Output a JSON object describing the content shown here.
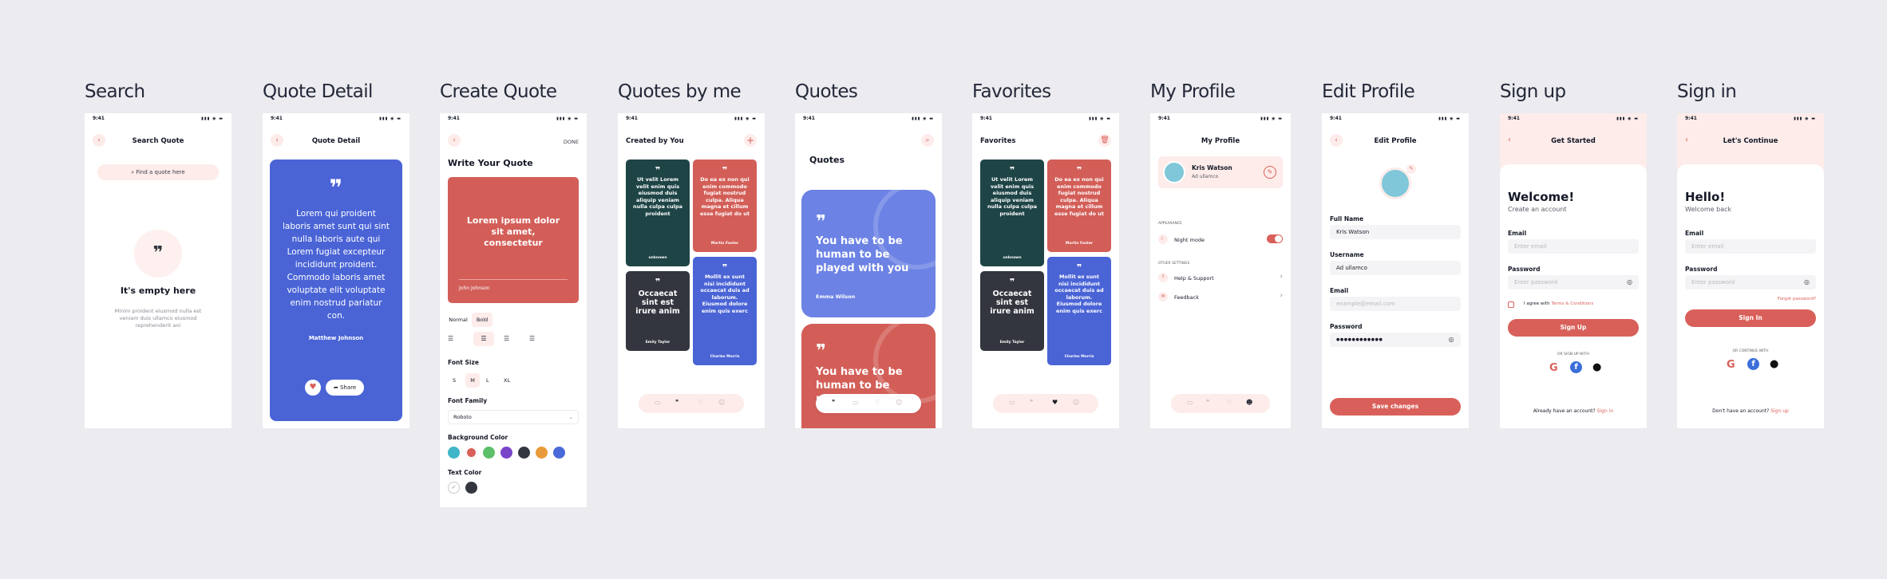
{
  "time": "9:41",
  "screens": {
    "search": {
      "title": "Search",
      "header": "Search Quote",
      "search_placeholder": "Find a quote here",
      "empty_title": "It's empty here",
      "empty_text": "Minim proident eiusmod nulla est veniam duis ullamco eiusmod reprehenderit ani"
    },
    "detail": {
      "title": "Quote Detail",
      "header": "Quote Detail",
      "quote": "Lorem qui proident laboris amet sunt qui sint nulla laboris aute qui Lorem fugiat excepteur incididunt proident. Commodo laboris amet voluptate elit voluptate enim nostrud pariatur con.",
      "author": "Matthew Johnson",
      "share": "Share"
    },
    "create": {
      "title": "Create Quote",
      "done": "DONE",
      "heading": "Write Your Quote",
      "preview_text": "Lorem ipsum dolor sit amet, consectetur",
      "preview_author": "John Johnson",
      "weight_normal": "Normal",
      "weight_bold": "Bold",
      "font_size_label": "Font Size",
      "sizes": [
        "S",
        "M",
        "L",
        "XL"
      ],
      "font_family_label": "Font Family",
      "font_family_value": "Roboto",
      "bg_label": "Background Color",
      "bg_colors": [
        "#3fb6c8",
        "#d9605a",
        "#5cbf6a",
        "#7a45c9",
        "#33363f",
        "#e99a3a",
        "#4a6ad9"
      ],
      "text_color_label": "Text Color"
    },
    "byme": {
      "title": "Quotes by me",
      "header": "Created by You",
      "cards": [
        {
          "text": "Ut velit Lorem velit enim quis eiusmod duis aliquip veniam nulla culpa culpa proident",
          "author": "unknown",
          "color": "#1e4446"
        },
        {
          "text": "Do ea ex non qui enim commodo fugiat nostrud culpa. Aliqua magna et cillum esse fugiat do ut",
          "author": "Martin Foster",
          "color": "#d35e58"
        },
        {
          "text": "Occaecat sint est irure anim",
          "author": "Emily Taylor",
          "color": "#33363f"
        },
        {
          "text": "Mollit ex sunt nisi incididunt occaecat duis ad laborum. Eiusmod dolore enim quis exerc",
          "author": "Charles Morris",
          "color": "#4a64d6"
        }
      ]
    },
    "quotes": {
      "title": "Quotes",
      "header": "Quotes",
      "card1_text": "You have to be human to be played with you",
      "card1_author": "Emma Wilson",
      "card2_text": "You have to be human to be played"
    },
    "favorites": {
      "title": "Favorites",
      "header": "Favorites"
    },
    "profile": {
      "title": "My Profile",
      "header": "My Profile",
      "name": "Kris Watson",
      "subtitle": "Ad ullamco",
      "appearance": "APPEARANCE",
      "night_mode": "Night mode",
      "other": "OTHER SETTINGS",
      "help": "Help & Support",
      "feedback": "Feedback"
    },
    "edit": {
      "title": "Edit Profile",
      "header": "Edit Profile",
      "fullname_label": "Full Name",
      "fullname_value": "Kris Watson",
      "username_label": "Username",
      "username_value": "Ad ullamco",
      "email_label": "Email",
      "email_placeholder": "example@email.com",
      "password_label": "Password",
      "password_value": "●●●●●●●●●●●●",
      "save": "Save changes"
    },
    "signup": {
      "title": "Sign up",
      "header": "Get Started",
      "welcome": "Welcome!",
      "sub": "Create an account",
      "email_label": "Email",
      "email_placeholder": "Enter email",
      "password_label": "Password",
      "password_placeholder": "Enter password",
      "agree": "I agree with",
      "terms": "Terms & Conditions",
      "button": "Sign Up",
      "or": "OR SIGN UP WITH",
      "have_account": "Already have an account?",
      "signin_link": "Sign in"
    },
    "signin": {
      "title": "Sign in",
      "header": "Let's Continue",
      "hello": "Hello!",
      "sub": "Welcome back",
      "email_label": "Email",
      "email_placeholder": "Enter email",
      "password_label": "Password",
      "password_placeholder": "Enter password",
      "forgot": "Forgot password?",
      "button": "Sign In",
      "or": "OR CONTINUE WITH",
      "no_account": "Don't have an account?",
      "signup_link": "Sign up"
    }
  },
  "colors": {
    "accent": "#d9605a",
    "blue": "#4a64d6",
    "dark": "#33363f",
    "teal": "#1e4446",
    "pink_bg": "#fdecea"
  }
}
